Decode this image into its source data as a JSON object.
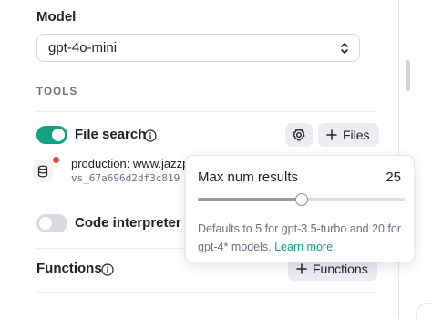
{
  "model": {
    "label": "Model",
    "selected": "gpt-4o-mini",
    "icon": "chevron-updown-icon"
  },
  "tools": {
    "label": "TOOLS",
    "file_search": {
      "label": "File search",
      "enabled": true,
      "settings_icon": "gear-icon",
      "files_button": "Files"
    },
    "file": {
      "name": "production: www.jazzp",
      "id": "vs_67a696d2df3c819"
    },
    "code_interpreter": {
      "label": "Code interpreter",
      "enabled": false
    }
  },
  "functions": {
    "label": "Functions",
    "button": "Functions"
  },
  "popover": {
    "title": "Max num results",
    "value": "25",
    "slider_fraction": 0.5,
    "description": "Defaults to 5 for gpt-3.5-turbo and 20 for gpt-4* models.",
    "link": "Learn more."
  },
  "colors": {
    "accent": "#10a37f",
    "badge": "#ef4146"
  }
}
